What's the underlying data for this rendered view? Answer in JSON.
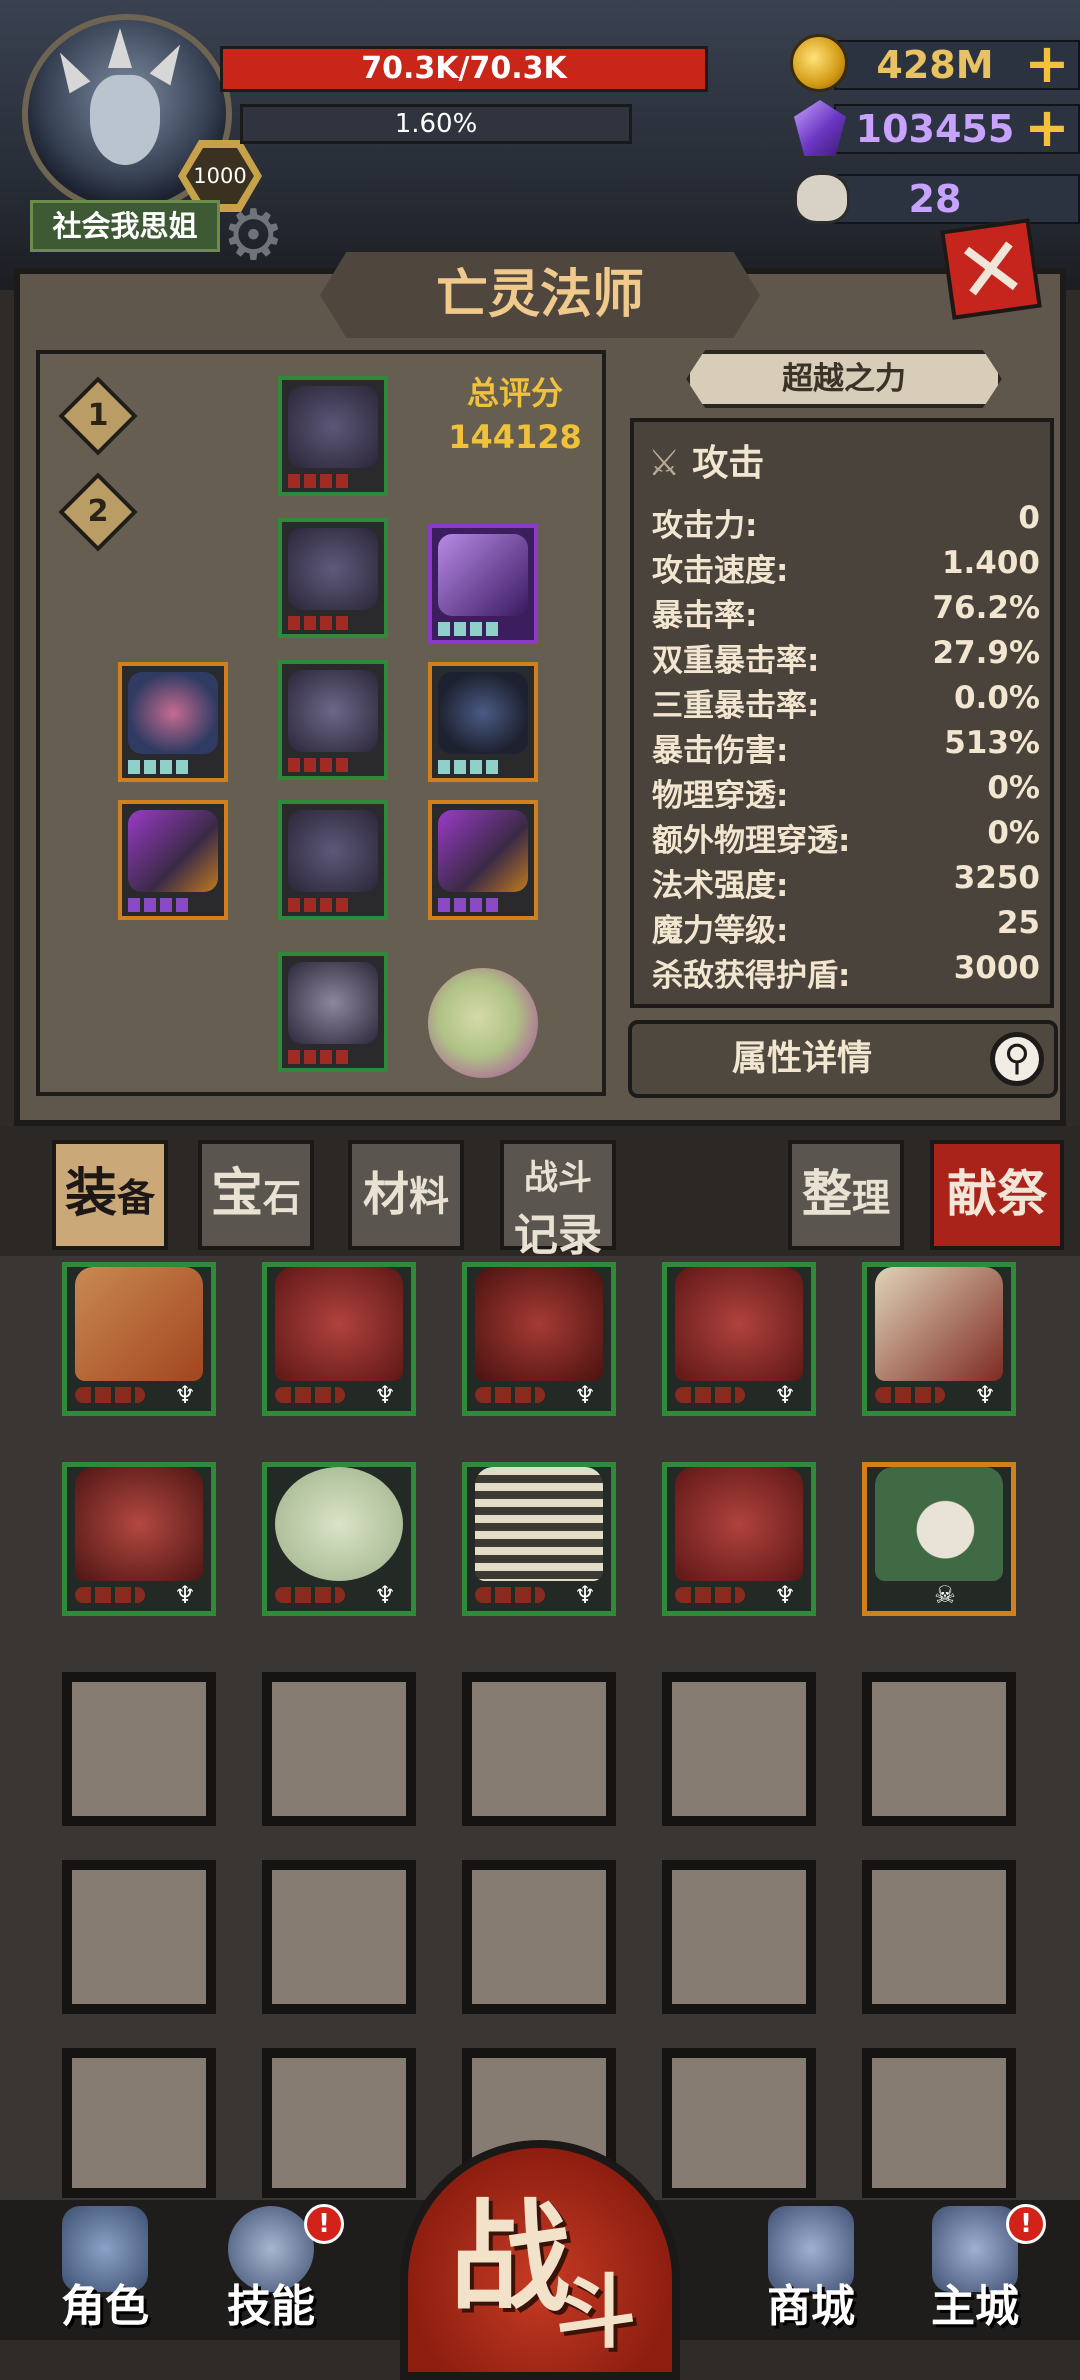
{
  "header": {
    "player_name": "社会我思姐",
    "level": "1000",
    "hp": "70.3K/70.3K",
    "xp_percent_text": "1.60%",
    "resources": [
      {
        "name": "gold",
        "value": "428M",
        "icon": "gold-coin-icon",
        "color": "#e9c261",
        "has_plus": true
      },
      {
        "name": "gems",
        "value": "103455",
        "icon": "purple-gem-icon",
        "color": "#c8a2ff",
        "has_plus": true
      },
      {
        "name": "skulls",
        "value": "28",
        "icon": "ram-skull-icon",
        "color": "#c8a2ff",
        "has_plus": false
      }
    ],
    "plus_symbol": "+",
    "close_symbol": "✕"
  },
  "character": {
    "class_title": "亡灵法师",
    "set_tabs": [
      "1",
      "2"
    ],
    "score_label": "总评分",
    "score_value": "144128"
  },
  "stats": {
    "beyond_button": "超越之力",
    "section_title": "攻击",
    "rows": [
      {
        "label": "攻击力:",
        "value": "0"
      },
      {
        "label": "攻击速度:",
        "value": "1.400"
      },
      {
        "label": "暴击率:",
        "value": "76.2%"
      },
      {
        "label": "双重暴击率:",
        "value": "27.9%"
      },
      {
        "label": "三重暴击率:",
        "value": "0.0%"
      },
      {
        "label": "暴击伤害:",
        "value": "513%"
      },
      {
        "label": "物理穿透:",
        "value": "0%"
      },
      {
        "label": "额外物理穿透:",
        "value": "0%"
      },
      {
        "label": "法术强度:",
        "value": "3250"
      },
      {
        "label": "魔力等级:",
        "value": "25"
      },
      {
        "label": "杀敌获得护盾:",
        "value": "3000"
      }
    ],
    "detail_button": "属性详情"
  },
  "tabs": {
    "equipment": [
      "装",
      "备"
    ],
    "gems": [
      "宝",
      "石"
    ],
    "materials": [
      "材",
      "料"
    ],
    "battle_log": [
      "战斗",
      "记录"
    ],
    "organize": [
      "整",
      "理"
    ],
    "sacrifice": "献祭"
  },
  "bottom_nav": {
    "character": "角色",
    "skills": "技能",
    "battle": [
      "战",
      "斗"
    ],
    "shop": "商城",
    "main_city": "主城",
    "badge": "!"
  }
}
